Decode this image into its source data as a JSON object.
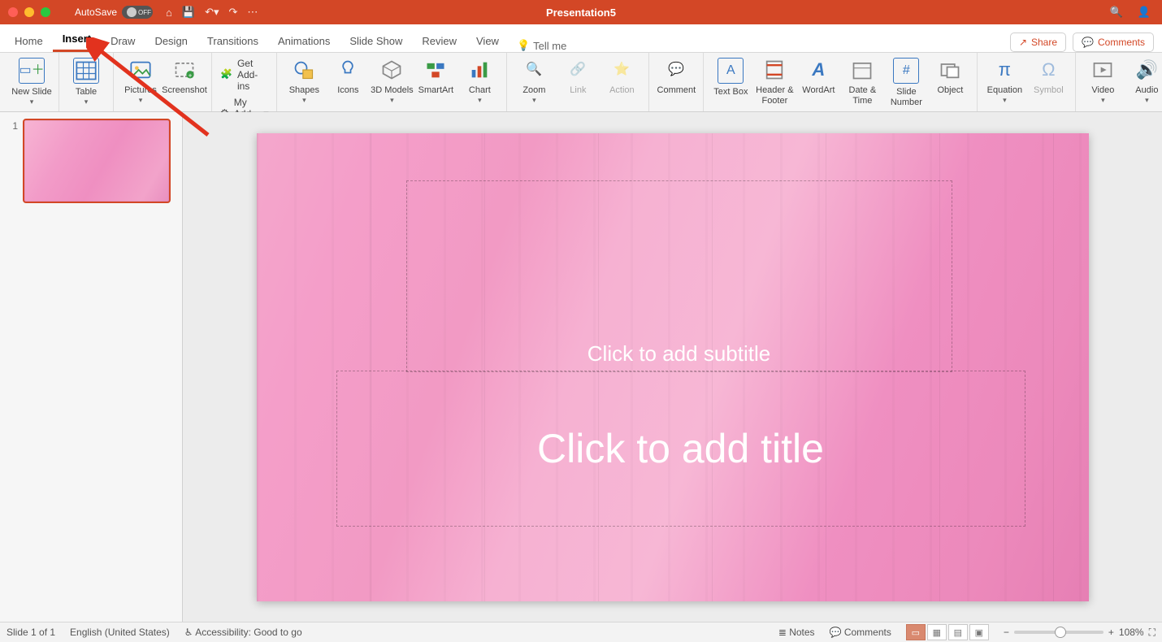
{
  "window": {
    "title": "Presentation5",
    "autosave_label": "AutoSave",
    "autosave_state": "OFF"
  },
  "tabs": {
    "items": [
      "Home",
      "Insert",
      "Draw",
      "Design",
      "Transitions",
      "Animations",
      "Slide Show",
      "Review",
      "View"
    ],
    "active": "Insert",
    "tellme": "Tell me"
  },
  "tabbar_right": {
    "share": "Share",
    "comments": "Comments"
  },
  "ribbon": {
    "new_slide": "New Slide",
    "table": "Table",
    "pictures": "Pictures",
    "screenshot": "Screenshot",
    "get_addins": "Get Add-ins",
    "my_addins": "My Add-ins",
    "shapes": "Shapes",
    "icons": "Icons",
    "models": "3D Models",
    "smartart": "SmartArt",
    "chart": "Chart",
    "zoom": "Zoom",
    "link": "Link",
    "action": "Action",
    "comment": "Comment",
    "textbox": "Text Box",
    "headerfooter": "Header & Footer",
    "wordart": "WordArt",
    "datetime": "Date & Time",
    "slidenum": "Slide Number",
    "object": "Object",
    "equation": "Equation",
    "symbol": "Symbol",
    "video": "Video",
    "audio": "Audio"
  },
  "thumbnails": {
    "items": [
      {
        "num": "1"
      }
    ]
  },
  "slide": {
    "title_placeholder": "Click to add title",
    "subtitle_placeholder": "Click to add subtitle"
  },
  "status": {
    "slide_counter": "Slide 1 of 1",
    "language": "English (United States)",
    "accessibility": "Accessibility: Good to go",
    "notes": "Notes",
    "comments": "Comments",
    "zoom": "108%"
  }
}
